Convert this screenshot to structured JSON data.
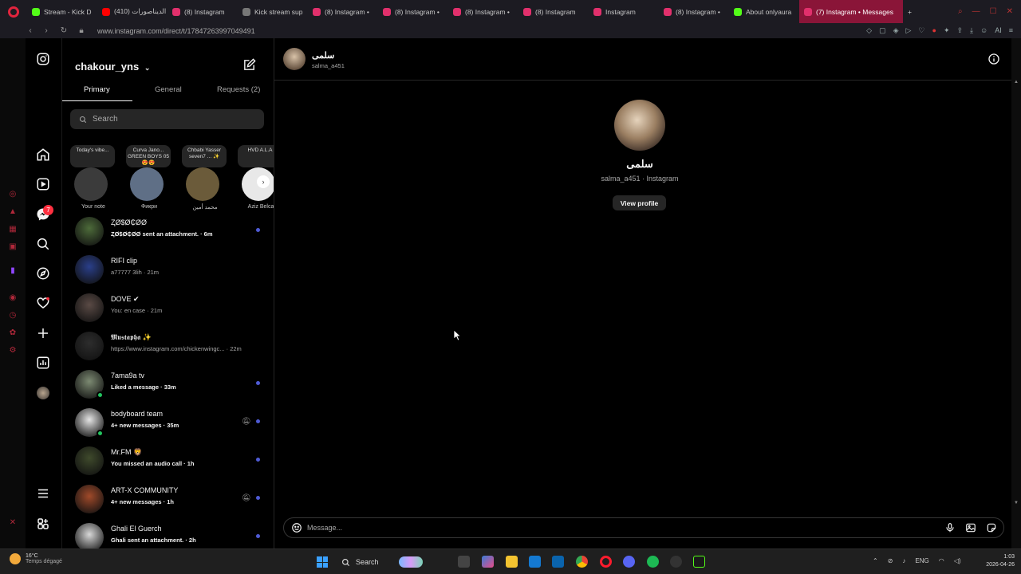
{
  "browser": {
    "tabs": [
      {
        "label": "Stream - Kick D",
        "color": "#53fc18"
      },
      {
        "label": "الديناصورات (410)",
        "color": "#ff0000"
      },
      {
        "label": "(8) Instagram",
        "color": "#e1306c"
      },
      {
        "label": "Kick stream sup",
        "color": "#777777"
      },
      {
        "label": "(8) Instagram •",
        "color": "#e1306c"
      },
      {
        "label": "(8) Instagram •",
        "color": "#e1306c"
      },
      {
        "label": "(8) Instagram •",
        "color": "#e1306c"
      },
      {
        "label": "(8) Instagram",
        "color": "#e1306c"
      },
      {
        "label": "Instagram",
        "color": "#e1306c"
      },
      {
        "label": "(8) Instagram •",
        "color": "#e1306c"
      },
      {
        "label": "About onlyaura",
        "color": "#53fc18"
      },
      {
        "label": "(7) Instagram • Messages",
        "color": "#e1306c",
        "active": true
      }
    ],
    "url": "www.instagram.com/direct/t/17847263997049491",
    "ai_label": "AI"
  },
  "sidebar": {
    "username": "chakour_yns",
    "messages_badge": "7",
    "tabs": [
      "Primary",
      "General",
      "Requests (2)"
    ],
    "search_placeholder": "Search"
  },
  "notes": [
    {
      "bubble": "Today's vibe...",
      "name": "Your note",
      "avatar": "#3b3b3b"
    },
    {
      "bubble": "Curva Jano... GREEN BOYS 05 😍😍",
      "name": "Фикри",
      "avatar": "#5f6f86"
    },
    {
      "bubble": "Chbabi Yasser seven7 ... ✨",
      "name": "محمد أمين",
      "avatar": "#6b5b3a"
    },
    {
      "bubble": "HVD A.L.A",
      "name": "Aziz Belca",
      "avatar": "#e8e8e8"
    }
  ],
  "conversations": [
    {
      "name": "ⱫØ$Ø₵ØØ",
      "sub": "ⱫØ$Ø₵ØØ sent an attachment. · 6m",
      "unread": true,
      "online": false,
      "muted": false,
      "avatar": "#4d6b3a"
    },
    {
      "name": "RIFI clip",
      "sub": "a77777 3lih · 21m",
      "unread": false,
      "online": false,
      "muted": false,
      "avatar": "#2a3f8a"
    },
    {
      "name": "DOVE ✔",
      "sub": "You: en case · 21m",
      "unread": false,
      "online": false,
      "muted": false,
      "avatar": "#5a4a45"
    },
    {
      "name": "𝕸𝖚𝖘𝖙𝖆𝖕𝖍𝖆 ✨",
      "sub": "https://www.instagram.com/chickenwingc... · 22m",
      "unread": false,
      "online": false,
      "muted": false,
      "avatar": "#2d2d2d"
    },
    {
      "name": "7ama9a tv",
      "sub": "Liked a message · 33m",
      "unread": true,
      "online": true,
      "muted": false,
      "avatar": "#7c8a72"
    },
    {
      "name": "bodyboard team",
      "sub": "4+ new messages · 35m",
      "unread": true,
      "online": true,
      "muted": true,
      "avatar": "#e5e5e5"
    },
    {
      "name": "Mr.FM 🦁",
      "sub": "You missed an audio call · 1h",
      "unread": true,
      "online": false,
      "muted": false,
      "avatar": "#3f4a2c"
    },
    {
      "name": "ART-X COMMUNITY",
      "sub": "4+ new messages · 1h",
      "unread": true,
      "online": false,
      "muted": true,
      "avatar": "#a04a2a"
    },
    {
      "name": "Ghali El Guerch",
      "sub": "Ghali sent an attachment. · 2h",
      "unread": true,
      "online": false,
      "muted": false,
      "avatar": "#d8d8d8"
    }
  ],
  "chat": {
    "name": "سلمى",
    "username": "salma_a451",
    "profile_sub": "salma_a451 · Instagram",
    "view_profile": "View profile",
    "message_placeholder": "Message..."
  },
  "taskbar": {
    "temperature": "16°C",
    "weather": "Temps dégagé",
    "search": "Search",
    "lang": "ENG",
    "time": "1:03",
    "date": "2026-04-26"
  },
  "icons": [
    "instagram-logo-icon",
    "home-icon",
    "reels-icon",
    "messenger-icon",
    "search-icon",
    "explore-icon",
    "heart-icon",
    "create-icon",
    "dashboard-icon",
    "menu-icon",
    "threads-icon",
    "compose-icon",
    "info-icon",
    "emoji-icon",
    "mic-icon",
    "image-icon",
    "sticker-icon"
  ]
}
